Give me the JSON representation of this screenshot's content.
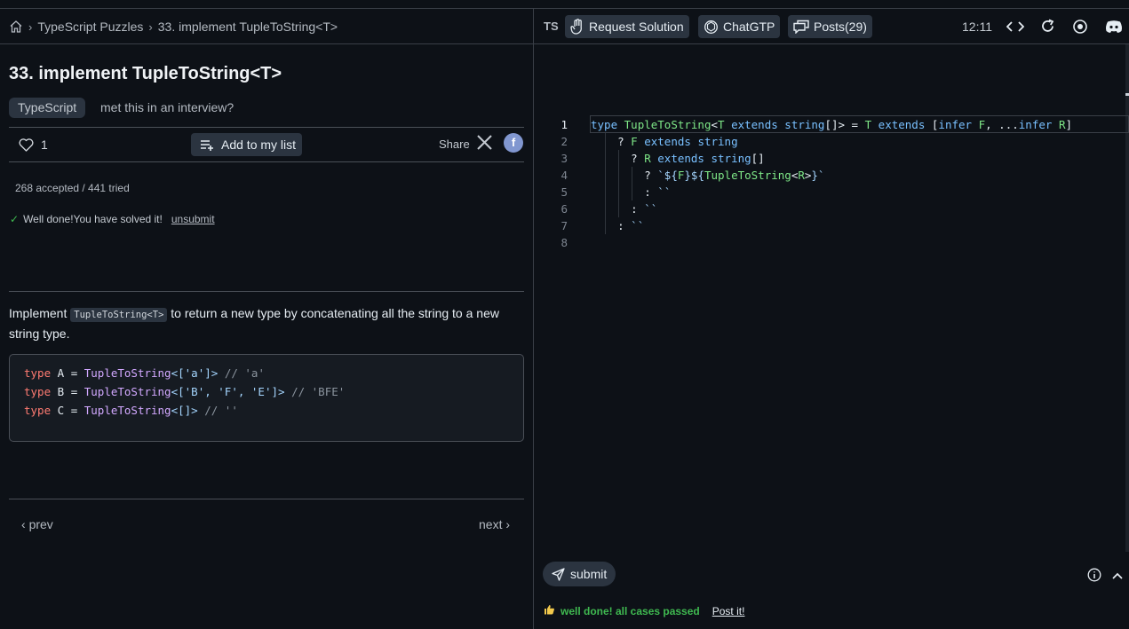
{
  "breadcrumb": {
    "items": [
      "TypeScript Puzzles",
      "33. implement TupleToString<T>"
    ]
  },
  "problem": {
    "title": "33. implement TupleToString<T>",
    "tag": "TypeScript",
    "interview_link": "met this in an interview?",
    "likes": "1",
    "add_to_list": "Add to my list",
    "share_label": "Share",
    "stats": "268 accepted / 441 tried",
    "solved_msg": "Well done!You have solved it!",
    "unsubmit": "unsubmit",
    "desc_before": "Implement ",
    "desc_code": "TupleToString<T>",
    "desc_after": " to return a new type by concatenating all the string to a new string type.",
    "examples": [
      {
        "kw": "type",
        "name": "A",
        "eq": " = ",
        "fn": "TupleToString",
        "args": "<['a']>",
        "comment": "// 'a'"
      },
      {
        "kw": "type",
        "name": "B",
        "eq": " = ",
        "fn": "TupleToString",
        "args": "<['B', 'F', 'E']>",
        "comment": "// 'BFE'"
      },
      {
        "kw": "type",
        "name": "C",
        "eq": " = ",
        "fn": "TupleToString",
        "args": "<[]>",
        "comment": "// ''"
      }
    ],
    "prev": "prev",
    "next": "next"
  },
  "toolbar": {
    "lang": "TS",
    "request_solution": "Request Solution",
    "chatgtp": "ChatGTP",
    "posts": "Posts(29)",
    "timer": "12:11"
  },
  "editor": {
    "line_numbers": [
      "1",
      "2",
      "3",
      "4",
      "5",
      "6",
      "7",
      "8"
    ]
  },
  "footer": {
    "submit": "submit",
    "result": "well done! all cases passed",
    "post_it": "Post it!"
  },
  "colors": {
    "background": "#0d1117",
    "accent_green": "#3fb950",
    "panel": "#2b3440"
  }
}
